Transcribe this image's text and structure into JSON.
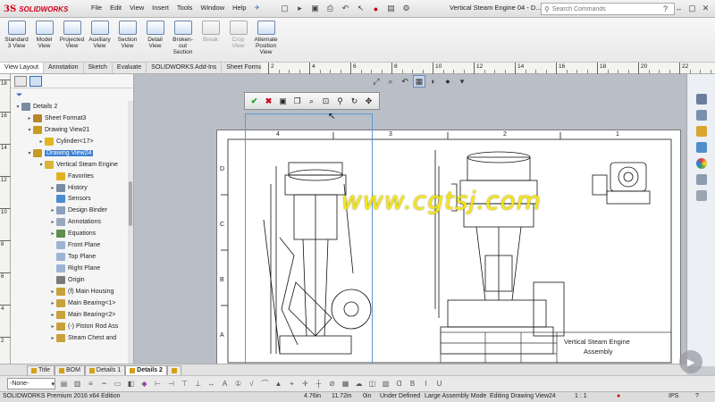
{
  "app": {
    "logo_prefix": "3S",
    "logo_name": "SOLIDWORKS",
    "document_title": "Vertical Steam Engine 04 - D..."
  },
  "menu": [
    "File",
    "Edit",
    "View",
    "Insert",
    "Tools",
    "Window",
    "Help"
  ],
  "search": {
    "placeholder": "Search Commands"
  },
  "ribbon": [
    {
      "label": "Standard\n3 View",
      "disabled": false
    },
    {
      "label": "Model\nView",
      "disabled": false
    },
    {
      "label": "Projected\nView",
      "disabled": false
    },
    {
      "label": "Auxiliary\nView",
      "disabled": false
    },
    {
      "label": "Section\nView",
      "disabled": false
    },
    {
      "label": "Detail\nView",
      "disabled": false
    },
    {
      "label": "Broken-out\nSection",
      "disabled": false
    },
    {
      "label": "Break",
      "disabled": true
    },
    {
      "label": "Crop\nView",
      "disabled": true
    },
    {
      "label": "Alternate\nPosition\nView",
      "disabled": false
    }
  ],
  "tabs": [
    {
      "label": "View Layout",
      "active": true
    },
    {
      "label": "Annotation",
      "active": false
    },
    {
      "label": "Sketch",
      "active": false
    },
    {
      "label": "Evaluate",
      "active": false
    },
    {
      "label": "SOLIDWORKS Add-Ins",
      "active": false
    },
    {
      "label": "Sheet Format",
      "active": false
    }
  ],
  "ruler_labels": [
    "2",
    "4",
    "6",
    "8",
    "10",
    "12",
    "14",
    "16",
    "18",
    "20",
    "22"
  ],
  "vruler_labels": [
    "18",
    "16",
    "14",
    "12",
    "10",
    "8",
    "6",
    "4",
    "2"
  ],
  "tree": [
    {
      "label": "Details 2",
      "indent": 0,
      "arrow": "▾",
      "color": "#7a8ca3",
      "selected": false
    },
    {
      "label": "Sheet Format3",
      "indent": 1,
      "arrow": "▸",
      "color": "#b8862b",
      "selected": false
    },
    {
      "label": "Drawing View21",
      "indent": 1,
      "arrow": "▾",
      "color": "#c79a22",
      "selected": false
    },
    {
      "label": "Cylinder<17>",
      "indent": 2,
      "arrow": "▸",
      "color": "#e0b81e",
      "selected": false
    },
    {
      "label": "Drawing View24",
      "indent": 1,
      "arrow": "▾",
      "color": "#c79a22",
      "selected": true
    },
    {
      "label": "Vertical Steam Engine",
      "indent": 2,
      "arrow": "▾",
      "color": "#d8b53a",
      "selected": false
    },
    {
      "label": "Favorites",
      "indent": 3,
      "arrow": "",
      "color": "#e1b21f",
      "selected": false
    },
    {
      "label": "History",
      "indent": 3,
      "arrow": "▸",
      "color": "#7a8ca3",
      "selected": false
    },
    {
      "label": "Sensors",
      "indent": 3,
      "arrow": "",
      "color": "#4b8bd0",
      "selected": false
    },
    {
      "label": "Design Binder",
      "indent": 3,
      "arrow": "▸",
      "color": "#8aa0be",
      "selected": false
    },
    {
      "label": "Annotations",
      "indent": 3,
      "arrow": "▸",
      "color": "#9aa8bd",
      "selected": false
    },
    {
      "label": "Equations",
      "indent": 3,
      "arrow": "▸",
      "color": "#5d8f4a",
      "selected": false
    },
    {
      "label": "Front Plane",
      "indent": 3,
      "arrow": "",
      "color": "#9db3d3",
      "selected": false
    },
    {
      "label": "Top Plane",
      "indent": 3,
      "arrow": "",
      "color": "#9db3d3",
      "selected": false
    },
    {
      "label": "Right Plane",
      "indent": 3,
      "arrow": "",
      "color": "#9db3d3",
      "selected": false
    },
    {
      "label": "Origin",
      "indent": 3,
      "arrow": "",
      "color": "#7a7a7a",
      "selected": false
    },
    {
      "label": "(f) Main Housing",
      "indent": 3,
      "arrow": "▸",
      "color": "#c9a13a",
      "selected": false
    },
    {
      "label": "Main Bearing<1>",
      "indent": 3,
      "arrow": "▸",
      "color": "#c9a13a",
      "selected": false
    },
    {
      "label": "Main Bearing<2>",
      "indent": 3,
      "arrow": "▸",
      "color": "#c9a13a",
      "selected": false
    },
    {
      "label": "(-) Piston Rod Ass",
      "indent": 3,
      "arrow": "▸",
      "color": "#c9a13a",
      "selected": false
    },
    {
      "label": "Steam Chest and",
      "indent": 3,
      "arrow": "▸",
      "color": "#c9a13a",
      "selected": false
    }
  ],
  "sheet": {
    "col_labels": [
      "4",
      "3",
      "2",
      "1"
    ],
    "row_labels": [
      "D",
      "C",
      "B",
      "A"
    ],
    "title_block_name": "Vertical Steam Engine",
    "title_block_sub": "Assembly"
  },
  "watermark": "www.cgtsj.com",
  "sheet_tabs": [
    {
      "label": "Title",
      "active": false
    },
    {
      "label": "BOM",
      "active": false
    },
    {
      "label": "Details 1",
      "active": false
    },
    {
      "label": "Details 2",
      "active": true
    }
  ],
  "bottom": {
    "layer_select": "-None-"
  },
  "status": {
    "edition": "SOLIDWORKS Premium 2016 x64 Edition",
    "x": "4.76in",
    "y": "11.72in",
    "z": "0in",
    "state": "Under Defined",
    "mode": "Large Assembly Mode",
    "editing": "Editing Drawing View24",
    "scale": "1 : 1",
    "units": "IPS"
  }
}
